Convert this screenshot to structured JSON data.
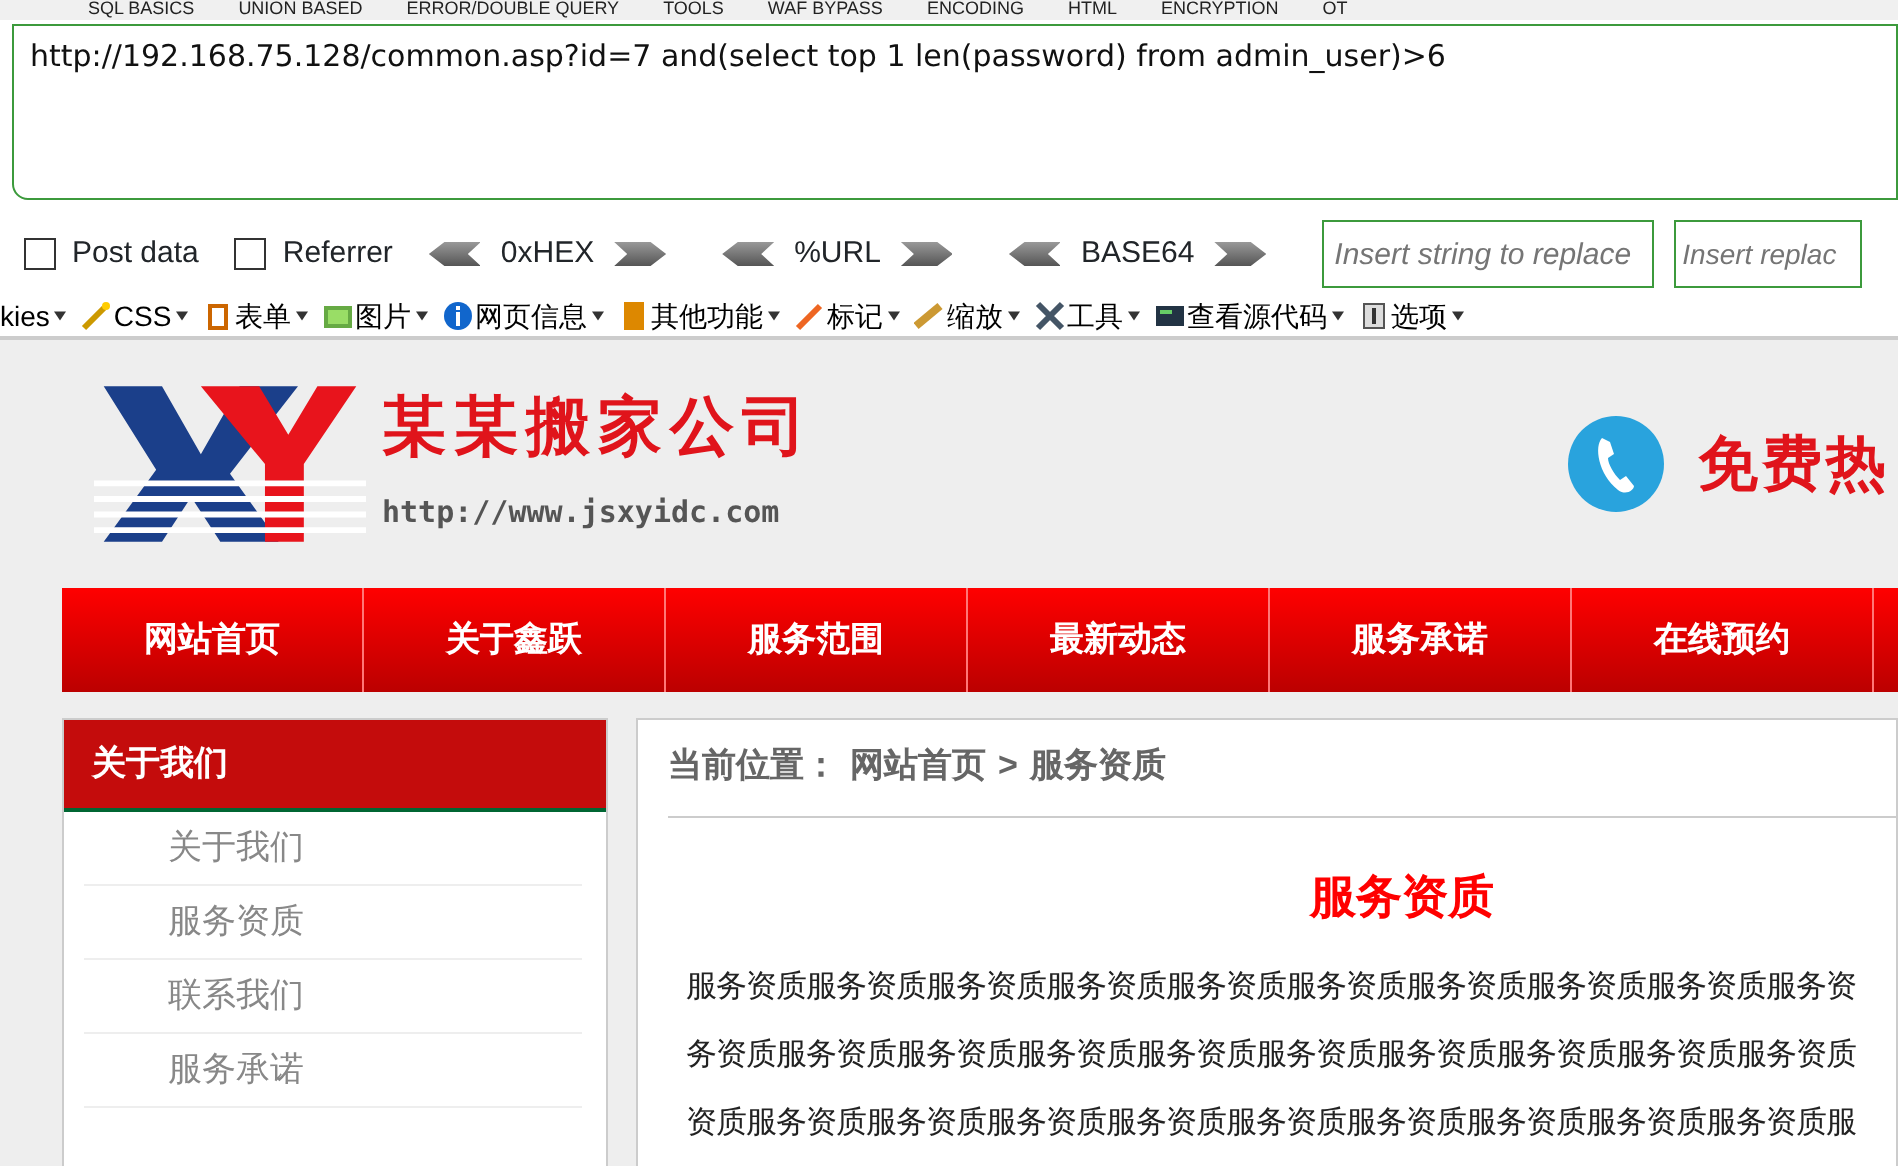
{
  "hackbar": {
    "menu": [
      "SQL BASICS",
      "UNION BASED",
      "ERROR/DOUBLE QUERY",
      "TOOLS",
      "WAF BYPASS",
      "ENCODING",
      "HTML",
      "ENCRYPTION",
      "OT"
    ],
    "url": "http://192.168.75.128/common.asp?id=7 and(select top 1 len(password) from admin_user)>6",
    "options": [
      {
        "label": "Post data",
        "checked": false
      },
      {
        "label": "Referrer",
        "checked": false
      }
    ],
    "encoders": [
      "0xHEX",
      "%URL",
      "BASE64"
    ],
    "replace_fields": [
      {
        "placeholder": "Insert string to replace"
      },
      {
        "placeholder": "Insert replac"
      }
    ]
  },
  "toolbar": [
    {
      "label": "kies"
    },
    {
      "label": "CSS"
    },
    {
      "label": "表单"
    },
    {
      "label": "图片"
    },
    {
      "label": "网页信息"
    },
    {
      "label": "其他功能"
    },
    {
      "label": "标记"
    },
    {
      "label": "缩放"
    },
    {
      "label": "工具"
    },
    {
      "label": "查看源代码"
    },
    {
      "label": "选项"
    }
  ],
  "site": {
    "logo": {
      "name": "某某搬家公司",
      "url": "http://www.jsxyidc.com"
    },
    "hotline": "免费热",
    "nav": [
      {
        "label": "网站首页"
      },
      {
        "label": "关于鑫跃"
      },
      {
        "label": "服务范围"
      },
      {
        "label": "最新动态"
      },
      {
        "label": "服务承诺"
      },
      {
        "label": "在线预约"
      }
    ],
    "sidebar": {
      "title": "关于我们",
      "items": [
        "关于我们",
        "服务资质",
        "联系我们",
        "服务承诺"
      ]
    },
    "breadcrumb": {
      "label": "当前位置：",
      "items": [
        "网站首页",
        "服务资质"
      ],
      "separator": ">"
    },
    "article": {
      "title": "服务资质",
      "lines": [
        "服务资质服务资质服务资质服务资质服务资质服务资质服务资质服务资质服务资质服务资",
        "务资质服务资质服务资质服务资质服务资质服务资质服务资质服务资质服务资质服务资质",
        "资质服务资质服务资质服务资质服务资质服务资质服务资质服务资质服务资质服务资质服"
      ]
    }
  }
}
